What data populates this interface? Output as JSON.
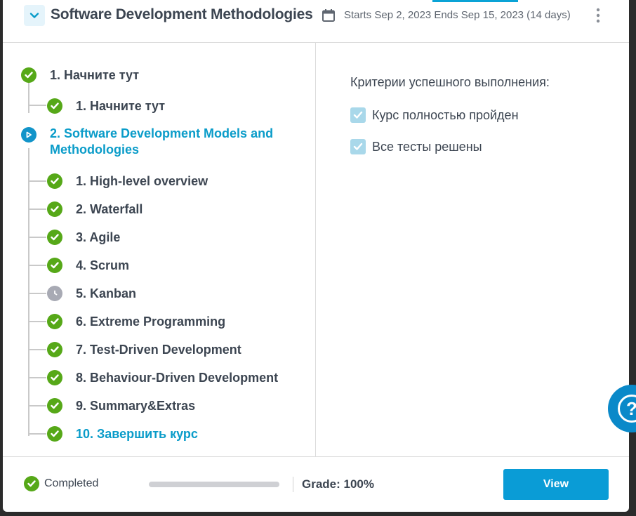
{
  "header": {
    "title": "Software Development Methodologies",
    "dates": "Starts Sep 2, 2023 Ends Sep 15, 2023 (14 days)",
    "collapse_icon": "chevron-down-icon",
    "calendar_icon": "calendar-icon",
    "more_icon": "kebab-menu-icon"
  },
  "outline": {
    "section1": {
      "title": "1. Начните тут",
      "status": "completed",
      "items": [
        {
          "label": "1. Начните тут",
          "status": "completed"
        }
      ]
    },
    "section2": {
      "title": "2. Software Development Models and Methodologies",
      "status": "in-progress",
      "items": [
        {
          "label": "1. High-level overview",
          "status": "completed"
        },
        {
          "label": "2. Waterfall",
          "status": "completed"
        },
        {
          "label": "3. Agile",
          "status": "completed"
        },
        {
          "label": "4. Scrum",
          "status": "completed"
        },
        {
          "label": "5. Kanban",
          "status": "pending"
        },
        {
          "label": "6. Extreme Programming",
          "status": "completed"
        },
        {
          "label": "7. Test-Driven Development",
          "status": "completed"
        },
        {
          "label": "8. Behaviour-Driven Development",
          "status": "completed"
        },
        {
          "label": "9. Summary&Extras",
          "status": "completed"
        },
        {
          "label": "10. Завершить курс",
          "status": "completed"
        }
      ]
    }
  },
  "criteria": {
    "title": "Критерии успешного выполнения:",
    "items": [
      {
        "label": "Курс полностью пройден",
        "checked": true
      },
      {
        "label": "Все тесты решены",
        "checked": true
      }
    ]
  },
  "footer": {
    "status": "Completed",
    "progress": 1.0,
    "grade": "Grade: 100%",
    "view_label": "View"
  },
  "help": {
    "icon": "help-icon",
    "glyph": "?"
  },
  "colors": {
    "accent": "#0a9cc9",
    "success": "#56a818",
    "text": "#3c4551",
    "pending": "#a8aab4"
  }
}
